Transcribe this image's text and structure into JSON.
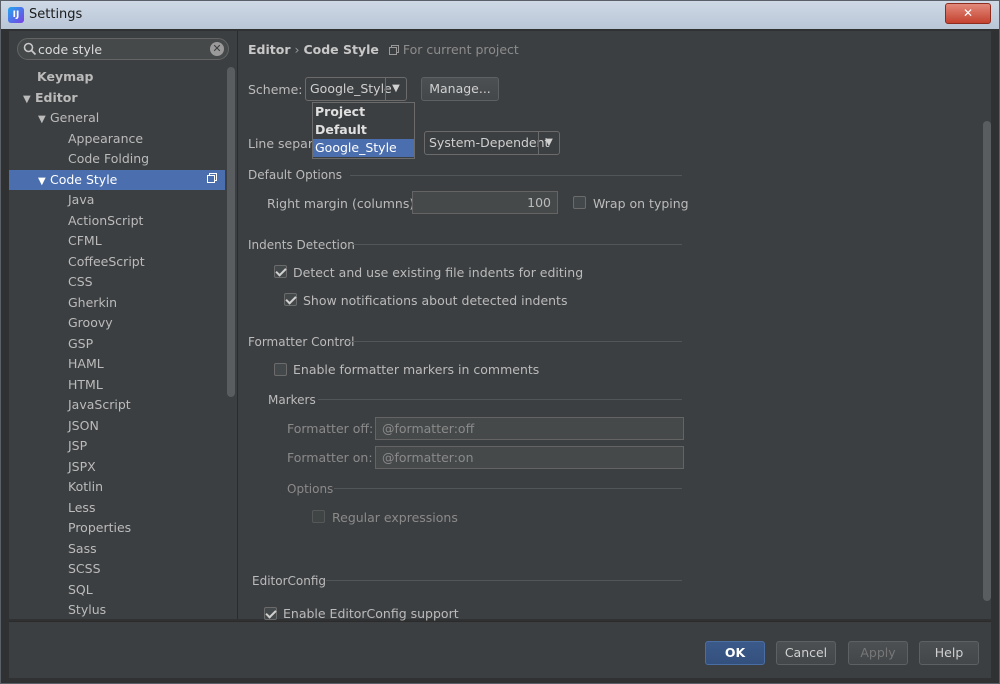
{
  "window": {
    "title": "Settings",
    "app_icon": "intellij-icon",
    "close_glyph": "✕"
  },
  "search": {
    "value": "code style",
    "clear_glyph": "✕"
  },
  "tree": [
    {
      "label": "Keymap"
    },
    {
      "label": "Editor",
      "arrow": "▼"
    },
    {
      "label": "General",
      "arrow": "▼"
    },
    {
      "label": "Appearance"
    },
    {
      "label": "Code Folding"
    },
    {
      "label": "Code Style",
      "arrow": "▼",
      "selected": true
    },
    {
      "label": "Java"
    },
    {
      "label": "ActionScript"
    },
    {
      "label": "CFML"
    },
    {
      "label": "CoffeeScript"
    },
    {
      "label": "CSS"
    },
    {
      "label": "Gherkin"
    },
    {
      "label": "Groovy"
    },
    {
      "label": "GSP"
    },
    {
      "label": "HAML"
    },
    {
      "label": "HTML"
    },
    {
      "label": "JavaScript"
    },
    {
      "label": "JSON"
    },
    {
      "label": "JSP"
    },
    {
      "label": "JSPX"
    },
    {
      "label": "Kotlin"
    },
    {
      "label": "Less"
    },
    {
      "label": "Properties"
    },
    {
      "label": "Sass"
    },
    {
      "label": "SCSS"
    },
    {
      "label": "SQL"
    },
    {
      "label": "Stylus"
    }
  ],
  "breadcrumb": {
    "part1": "Editor",
    "sep": "›",
    "part2": "Code Style",
    "project_note": "For current project"
  },
  "scheme": {
    "label": "Scheme:",
    "value": "Google_Style",
    "manage": "Manage...",
    "dropdown_glyph": "▼"
  },
  "scheme_popup": {
    "items": [
      "Project",
      "Default",
      "Google_Style"
    ],
    "selected": "Google_Style"
  },
  "line_sep": {
    "label_prefix": "Line separ",
    "label_suffix": "):",
    "value": "System-Dependent"
  },
  "default_options": {
    "title": "Default Options",
    "right_margin_label": "Right margin (columns):",
    "right_margin_value": "100",
    "wrap_label": "Wrap on typing",
    "wrap_checked": false
  },
  "indents": {
    "title": "Indents Detection",
    "detect_label": "Detect and use existing file indents for editing",
    "detect_checked": true,
    "notify_label": "Show notifications about detected indents",
    "notify_checked": true
  },
  "formatter": {
    "title": "Formatter Control",
    "enable_label": "Enable formatter markers in comments",
    "enable_checked": false,
    "markers_title": "Markers",
    "off_label": "Formatter off:",
    "off_value": "@formatter:off",
    "on_label": "Formatter on:",
    "on_value": "@formatter:on",
    "options_title": "Options",
    "regex_label": "Regular expressions"
  },
  "editorconfig": {
    "title": "EditorConfig",
    "enable_label": "Enable EditorConfig support",
    "enable_checked": true
  },
  "buttons": {
    "ok": "OK",
    "cancel": "Cancel",
    "apply": "Apply",
    "help": "Help"
  },
  "colors": {
    "selection": "#4b6eaf",
    "background": "#3c3f41",
    "titlebar": "#c4d1e0"
  }
}
